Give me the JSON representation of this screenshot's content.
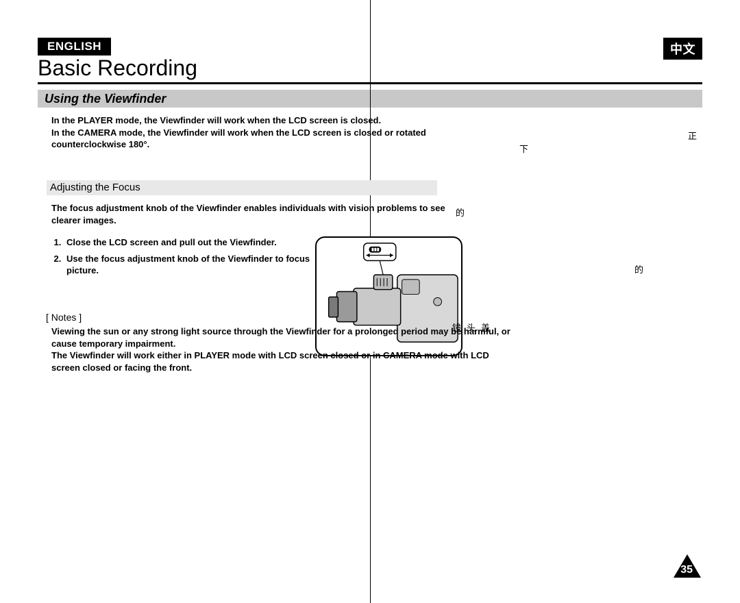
{
  "lang_left": "ENGLISH",
  "lang_right": "中文",
  "title": "Basic Recording",
  "section": "Using the Viewfinder",
  "intro_1": "In the PLAYER mode, the Viewfinder will work when the LCD screen is closed.",
  "intro_2": "In the CAMERA mode, the Viewfinder will work when the LCD screen is closed or rotated counterclockwise 180°.",
  "sub_section": "Adjusting the Focus",
  "focus_desc": "The focus adjustment knob of the Viewfinder enables individuals with vision problems to see clearer images.",
  "step_1": "Close the LCD screen and pull out the Viewfinder.",
  "step_2": "Use the focus adjustment knob of the Viewfinder to focus picture.",
  "notes_label": "[ Notes ]",
  "note_1": "Viewing the sun or any strong light source through the Viewfinder for a prolonged period may be harmful, or cause temporary impairment.",
  "note_2": "The Viewfinder will work either in PLAYER mode with LCD screen closed or in CAMERA mode with LCD screen closed or facing the front.",
  "stray_1": "下",
  "stray_2": "正",
  "stray_3": "的",
  "stray_4": "的",
  "stray_5": "镜头盖",
  "page_number": "35"
}
